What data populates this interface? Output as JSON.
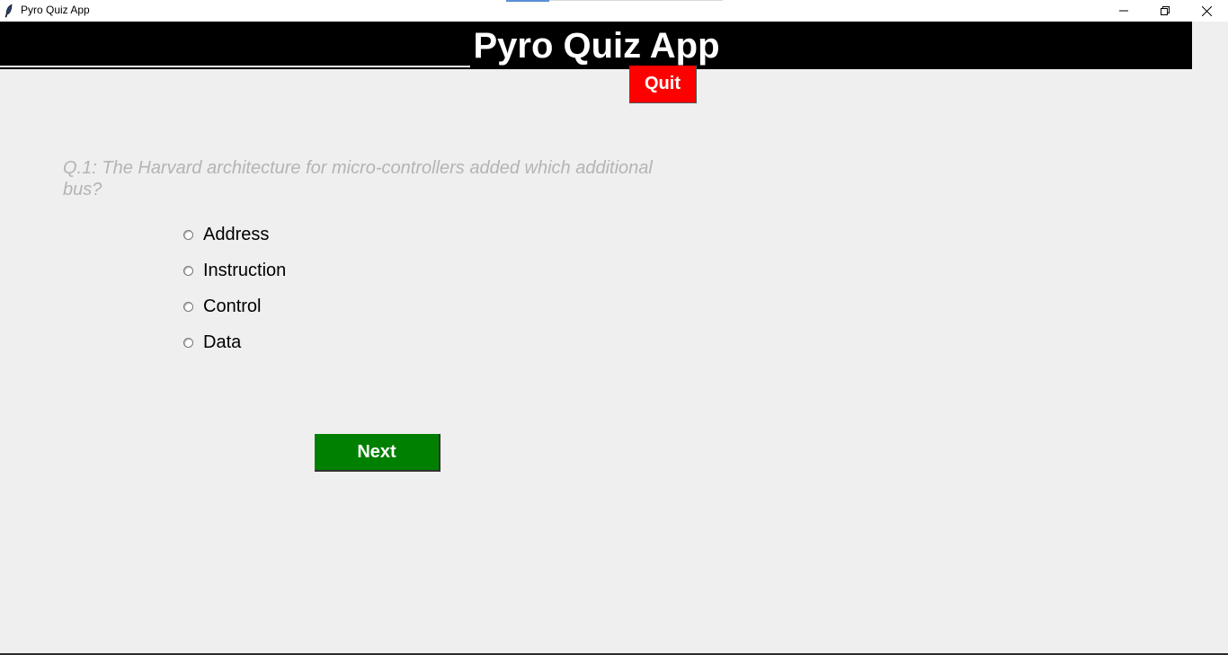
{
  "window": {
    "title": "Pyro Quiz App",
    "icon": "feather-icon"
  },
  "header": {
    "title": "Pyro Quiz App",
    "background": "#000000",
    "text_color": "#ffffff"
  },
  "quit_button": {
    "label": "Quit",
    "color": "#ff0000"
  },
  "question": {
    "text": "Q.1: The Harvard architecture for micro-controllers added which additional bus?",
    "color": "#b4b4b4"
  },
  "options": [
    {
      "label": "Address",
      "selected": false
    },
    {
      "label": "Instruction",
      "selected": false
    },
    {
      "label": "Control",
      "selected": false
    },
    {
      "label": "Data",
      "selected": false
    }
  ],
  "next_button": {
    "label": "Next",
    "color": "#008000"
  }
}
